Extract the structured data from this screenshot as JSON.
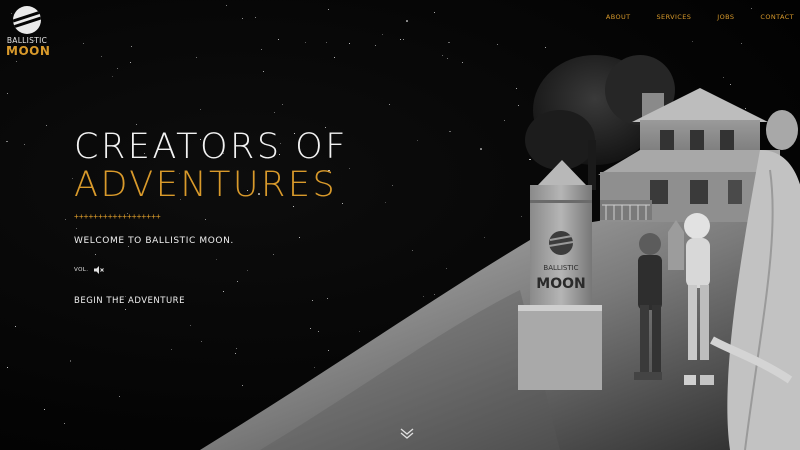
{
  "logo": {
    "line1": "BALLISTIC",
    "line2": "MOON",
    "icon": "moon-logo-icon"
  },
  "nav": {
    "items": [
      "ABOUT",
      "SERVICES",
      "JOBS",
      "CONTACT"
    ]
  },
  "hero": {
    "line1": "CREATORS OF",
    "line2": "ADVENTURES",
    "divider": "++++++++++++++++++",
    "welcome": "WELCOME TO BALLISTIC MOON.",
    "volume_label": "VOL.",
    "volume_icon": "speaker-muted-icon",
    "cta": "BEGIN THE ADVENTURE",
    "scroll_icon": "double-chevron-down-icon"
  },
  "sign": {
    "line1": "BALLISTIC",
    "line2": "MOON"
  },
  "colors": {
    "accent": "#d99a2b",
    "background": "#050505",
    "text": "#f0f0f0"
  }
}
